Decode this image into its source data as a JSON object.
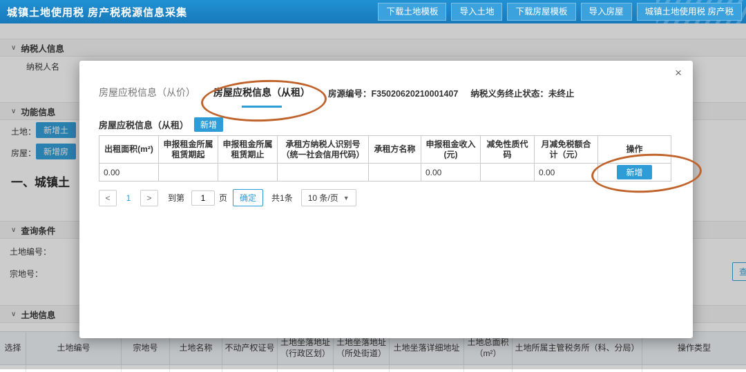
{
  "header": {
    "title": "城镇土地使用税 房产税税源信息采集",
    "buttons": [
      "下载土地模板",
      "导入土地",
      "下载房屋模板",
      "导入房屋",
      "城镇土地使用税 房产税"
    ]
  },
  "icons": {
    "collapse": "∨",
    "close": "×",
    "dropdown": "▼",
    "prev": "<",
    "next": ">"
  },
  "page": {
    "sections": {
      "taxpayer": "纳税人信息",
      "function": "功能信息",
      "query": "查询条件",
      "land": "土地信息"
    },
    "taxpayer_name_label": "纳税人名",
    "land_label": "土地：",
    "land_add_button": "新增土",
    "house_label": "房屋：",
    "house_add_button": "新增房",
    "heading": "一、城镇土",
    "land_no_label": "土地编号：",
    "parcel_no_label": "宗地号：",
    "query_button": "查询",
    "land_table_headers": [
      "选择",
      "土地编号",
      "宗地号",
      "土地名称",
      "不动产权证号",
      "土地坐落地址（行政区划）",
      "土地坐落地址（所处街道）",
      "土地坐落详细地址",
      "土地总面积（m²）",
      "土地所属主管税务所（科、分局）",
      "操作类型"
    ]
  },
  "modal": {
    "tabs": [
      {
        "label": "房屋应税信息（从价）"
      },
      {
        "label": "房屋应税信息（从租）"
      }
    ],
    "house_code_label": "房源编号：",
    "house_code": "F35020620210001407",
    "status_label": "纳税义务终止状态：",
    "status_value": "未终止",
    "section_title": "房屋应税信息（从租）",
    "add_button": "新增",
    "table": {
      "headers": [
        "出租面积(m²)",
        "申报租金所属租赁期起",
        "申报租金所属租赁期止",
        "承租方纳税人识别号（统一社会信用代码）",
        "承租方名称",
        "申报租金收入(元)",
        "减免性质代码",
        "月减免税额合计（元）",
        "操作"
      ],
      "row": [
        "0.00",
        "",
        "",
        "",
        "",
        "0.00",
        "",
        "0.00"
      ],
      "row_action": "新增"
    },
    "pagination": {
      "page": "1",
      "goto_label": "到第",
      "goto_value": "1",
      "page_unit": "页",
      "confirm": "确定",
      "total": "共1条",
      "page_size": "10 条/页"
    }
  }
}
